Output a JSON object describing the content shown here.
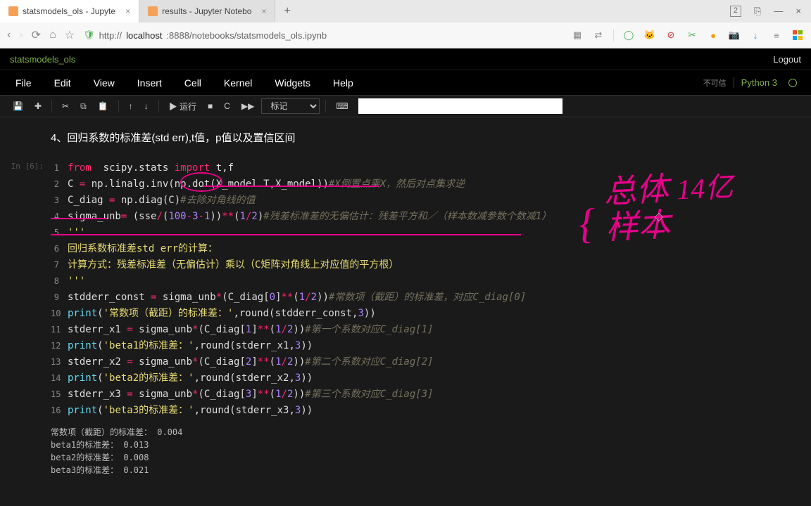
{
  "browser": {
    "tabs": [
      {
        "label": "statsmodels_ols - Jupyte",
        "active": true
      },
      {
        "label": "results - Jupyter Notebo",
        "active": false
      }
    ],
    "url_prefix": "http://",
    "url_host": "localhost",
    "url_port_path": ":8888/notebooks/statsmodels_ols.ipynb",
    "win_badge": "2"
  },
  "jupyter": {
    "title": "statsmodels_ols",
    "logout": "Logout",
    "menus": [
      "File",
      "Edit",
      "View",
      "Insert",
      "Cell",
      "Kernel",
      "Widgets",
      "Help"
    ],
    "kernel_trust": "不可信",
    "kernel_name": "Python 3",
    "toolbar": {
      "run_label": "运行",
      "celltype": "标记"
    }
  },
  "heading": "4、回归系数的标准差(std err),t值，p值以及置信区间",
  "prompt": "In [6]:",
  "code_lines": [
    {
      "n": "1",
      "html": "<span class='k-from'>from</span>  scipy.stats <span class='k-import'>import</span> t,f"
    },
    {
      "n": "2",
      "html": "C <span class='k-op'>=</span> np.linalg.inv(np.dot(X_model.T,X_model))<span class='k-cm'>#X倒置点乘X，然后对点集求逆</span>"
    },
    {
      "n": "3",
      "html": "C_diag <span class='k-op'>=</span> np.diag(C)<span class='k-cm'>#去除对角线的值</span>"
    },
    {
      "n": "4",
      "html": "sigma_unb<span class='k-op'>=</span> (sse<span class='k-op'>/</span>(<span class='k-num'>100</span><span class='k-op'>-</span><span class='k-num'>3</span><span class='k-op'>-</span><span class='k-num'>1</span>))<span class='k-op'>**</span>(<span class='k-num'>1</span><span class='k-op'>/</span><span class='k-num'>2</span>)<span class='k-cm'>#残差标准差的无偏估计：残差平方和／（样本数减参数个数减1）</span>"
    },
    {
      "n": "5",
      "html": "<span class='k-str'>'''</span>"
    },
    {
      "n": "6",
      "html": "<span class='k-str'>回归系数标准差std err的计算：</span>"
    },
    {
      "n": "7",
      "html": "<span class='k-str'>计算方式：残差标准差（无偏估计）乘以（C矩阵对角线上对应值的平方根）</span>"
    },
    {
      "n": "8",
      "html": "<span class='k-str'>'''</span>"
    },
    {
      "n": "9",
      "html": "stdderr_const <span class='k-op'>=</span> sigma_unb<span class='k-op'>*</span>(C_diag[<span class='k-num'>0</span>]<span class='k-op'>**</span>(<span class='k-num'>1</span><span class='k-op'>/</span><span class='k-num'>2</span>))<span class='k-cm'>#常数项（截距）的标准差，对应C_diag[0]</span>"
    },
    {
      "n": "10",
      "html": "<span class='k-fn'>print</span>(<span class='k-str'>'常数项（截距）的标准差：'</span>,round(stdderr_const,<span class='k-num'>3</span>))"
    },
    {
      "n": "11",
      "html": "stderr_x1 <span class='k-op'>=</span> sigma_unb<span class='k-op'>*</span>(C_diag[<span class='k-num'>1</span>]<span class='k-op'>**</span>(<span class='k-num'>1</span><span class='k-op'>/</span><span class='k-num'>2</span>))<span class='k-cm'>#第一个系数对应C_diag[1]</span>"
    },
    {
      "n": "12",
      "html": "<span class='k-fn'>print</span>(<span class='k-str'>'beta1的标准差：'</span>,round(stderr_x1,<span class='k-num'>3</span>))"
    },
    {
      "n": "13",
      "html": "stderr_x2 <span class='k-op'>=</span> sigma_unb<span class='k-op'>*</span>(C_diag[<span class='k-num'>2</span>]<span class='k-op'>**</span>(<span class='k-num'>1</span><span class='k-op'>/</span><span class='k-num'>2</span>))<span class='k-cm'>#第二个系数对应C_diag[2]</span>"
    },
    {
      "n": "14",
      "html": "<span class='k-fn'>print</span>(<span class='k-str'>'beta2的标准差：'</span>,round(stderr_x2,<span class='k-num'>3</span>))"
    },
    {
      "n": "15",
      "html": "stderr_x3 <span class='k-op'>=</span> sigma_unb<span class='k-op'>*</span>(C_diag[<span class='k-num'>3</span>]<span class='k-op'>**</span>(<span class='k-num'>1</span><span class='k-op'>/</span><span class='k-num'>2</span>))<span class='k-cm'>#第三个系数对应C_diag[3]</span>"
    },
    {
      "n": "16",
      "html": "<span class='k-fn'>print</span>(<span class='k-str'>'beta3的标准差：'</span>,round(stderr_x3,<span class='k-num'>3</span>))"
    }
  ],
  "output": "常数项（截距）的标准差： 0.004\nbeta1的标准差： 0.013\nbeta2的标准差： 0.008\nbeta3的标准差： 0.021",
  "handwriting": {
    "line1": "总体",
    "line1b": "14亿",
    "line2": "样本"
  }
}
